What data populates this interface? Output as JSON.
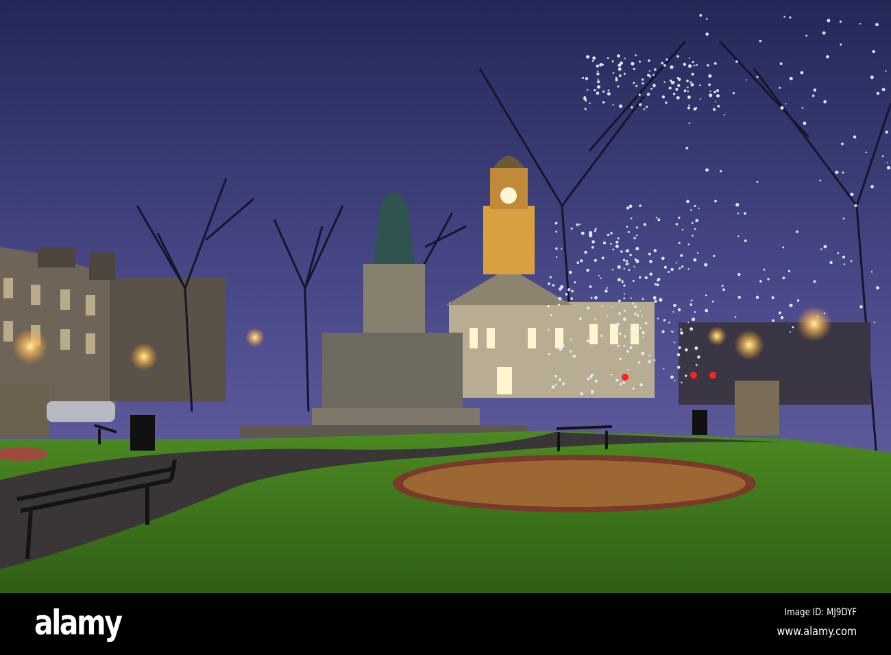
{
  "photo": {
    "subject": "Dalton Square at dusk with statue, clock tower town hall and lit trees",
    "watermark_text": "alamy"
  },
  "footer": {
    "logo": "alamy",
    "image_id": "Image ID: MJ9DYF",
    "url": "www.alamy.com"
  },
  "colors": {
    "sky_top": "#252a5c",
    "sky_horizon": "#6a66a8",
    "grass": "#3f7a1e",
    "lamp": "#ffd27a",
    "fairy_lights": "#cfe6ff"
  }
}
